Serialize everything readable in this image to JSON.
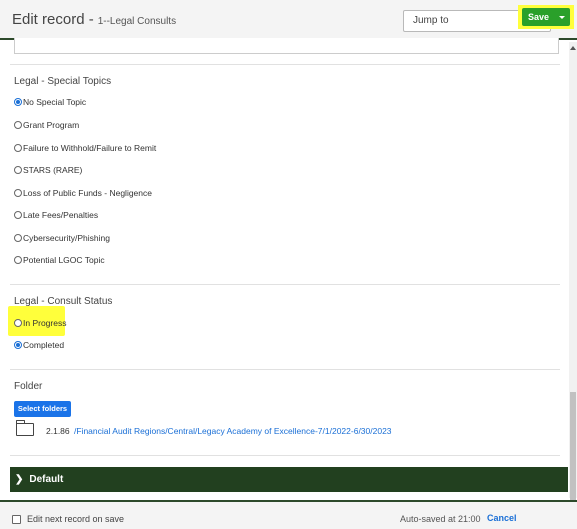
{
  "header": {
    "title": "Edit record -",
    "subtitle": "1--Legal Consults",
    "jump_label": "Jump to"
  },
  "special_topics": {
    "label": "Legal - Special Topics",
    "options": [
      {
        "label": "No Special Topic",
        "checked": true
      },
      {
        "label": "Grant Program",
        "checked": false
      },
      {
        "label": "Failure to Withhold/Failure to Remit",
        "checked": false
      },
      {
        "label": "STARS (RARE)",
        "checked": false
      },
      {
        "label": "Loss of Public Funds - Negligence",
        "checked": false
      },
      {
        "label": "Late Fees/Penalties",
        "checked": false
      },
      {
        "label": "Cybersecurity/Phishing",
        "checked": false
      },
      {
        "label": "Potential LGOC Topic",
        "checked": false
      }
    ]
  },
  "consult_status": {
    "label": "Legal - Consult Status",
    "options": [
      {
        "label": "In Progress",
        "checked": false
      },
      {
        "label": "Completed",
        "checked": true
      }
    ]
  },
  "folder": {
    "label": "Folder",
    "select_button": "Select folders",
    "item_id": "2.1.86",
    "item_path": "/Financial Audit Regions/Central/Legacy Academy of Excellence-7/1/2022-6/30/2023"
  },
  "default_section": {
    "label": "Default"
  },
  "footer": {
    "edit_next_label": "Edit next record on save",
    "autosaved": "Auto-saved at 21:00",
    "cancel_label": "Cancel",
    "save_label": "Save"
  },
  "colors": {
    "header_rule": "#2d4a2b",
    "section_bar": "#22401f",
    "link": "#1a6fd6",
    "highlight": "#ffff3b",
    "save": "#2aa02a"
  }
}
